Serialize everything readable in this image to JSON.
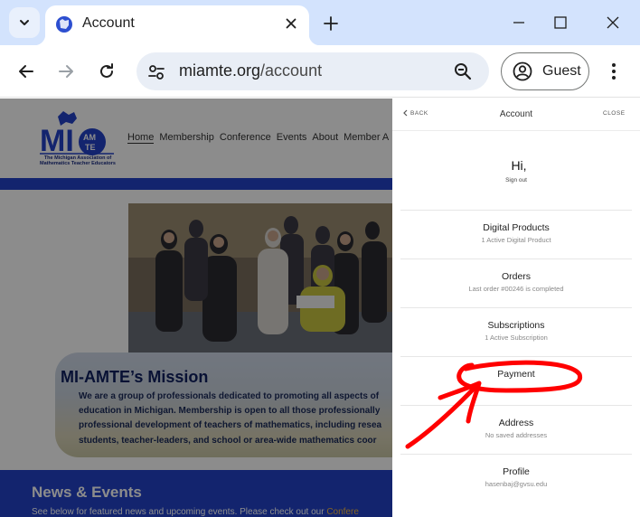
{
  "browser": {
    "tab": {
      "title": "Account"
    },
    "address": {
      "host": "miamte.org",
      "path": "/account"
    },
    "profile": {
      "label": "Guest"
    }
  },
  "site": {
    "logo": {
      "line1": "The Michigan Association of",
      "line2": "Mathematics Teacher Educators"
    },
    "nav": [
      "Home",
      "Membership",
      "Conference",
      "Events",
      "About",
      "Member A"
    ],
    "mission": {
      "title": "MI-AMTE’s Mission",
      "lines": [
        "We are a group of professionals dedicated to promoting all aspects of",
        "education in Michigan. Membership is open to all those professionally",
        "professional development of teachers of mathematics, including resea",
        "students, teacher-leaders, and school or area-wide mathematics coor"
      ]
    },
    "news": {
      "title": "News & Events",
      "subtitle": "See below for featured news and upcoming events. Please check out our ",
      "subtitle_link": "Confere"
    }
  },
  "drawer": {
    "back_label": "BACK",
    "title": "Account",
    "close_label": "CLOSE",
    "greeting": "Hi,",
    "signout_label": "Sign out",
    "items": [
      {
        "label": "Digital Products",
        "sub": "1 Active Digital Product"
      },
      {
        "label": "Orders",
        "sub": "Last order #00246 is completed"
      },
      {
        "label": "Subscriptions",
        "sub": "1 Active Subscription"
      },
      {
        "label": "Payment",
        "sub": ""
      },
      {
        "label": "Address",
        "sub": "No saved addresses"
      },
      {
        "label": "Profile",
        "sub": "hasenbaj@gvsu.edu"
      }
    ]
  },
  "colors": {
    "brand_blue": "#2342c8",
    "annotation_red": "#ff0000",
    "tabstrip": "#d3e3fd"
  }
}
